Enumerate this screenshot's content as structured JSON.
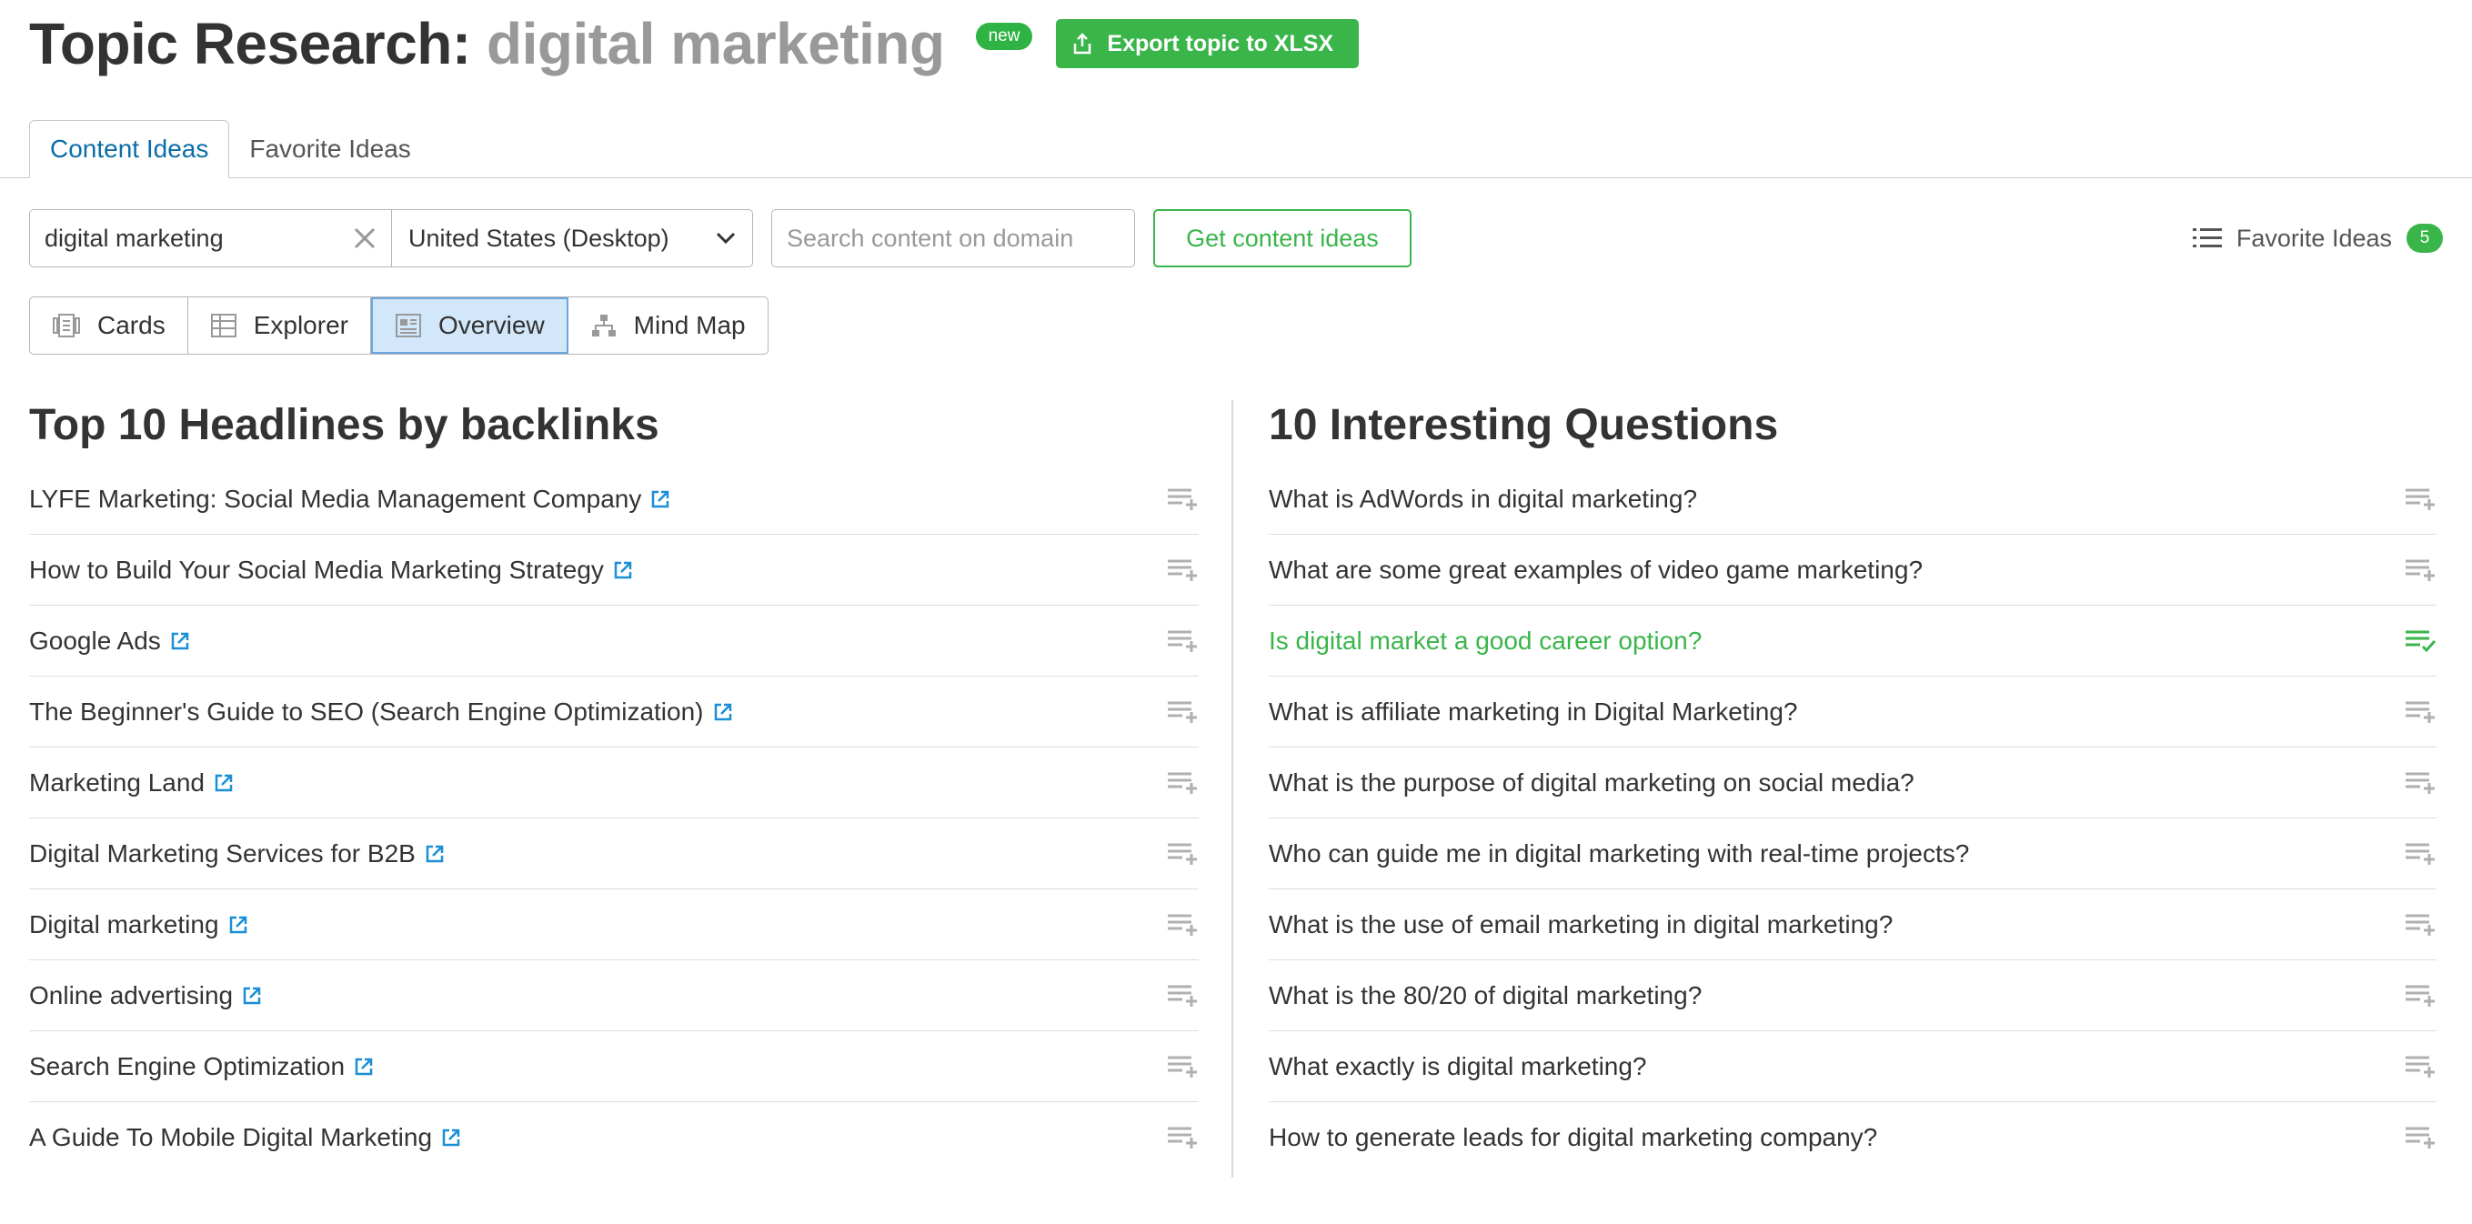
{
  "header": {
    "title_prefix": "Topic Research:",
    "title_keyword": "digital marketing",
    "badge": "new",
    "export_label": "Export topic to XLSX"
  },
  "tabs": [
    {
      "label": "Content Ideas",
      "active": true
    },
    {
      "label": "Favorite Ideas",
      "active": false
    }
  ],
  "search": {
    "keyword_value": "digital marketing",
    "region_value": "United States (Desktop)",
    "domain_placeholder": "Search content on domain",
    "submit_label": "Get content ideas"
  },
  "favorites": {
    "label": "Favorite Ideas",
    "count": "5"
  },
  "views": [
    {
      "label": "Cards",
      "icon": "cards-icon",
      "active": false
    },
    {
      "label": "Explorer",
      "icon": "table-icon",
      "active": false
    },
    {
      "label": "Overview",
      "icon": "overview-icon",
      "active": true
    },
    {
      "label": "Mind Map",
      "icon": "mind-map-icon",
      "active": false
    }
  ],
  "headlines": {
    "title": "Top 10 Headlines by backlinks",
    "items": [
      "LYFE Marketing: Social Media Management Company",
      "How to Build Your Social Media Marketing Strategy",
      "Google Ads",
      "The Beginner's Guide to SEO (Search Engine Optimization)",
      "Marketing Land",
      "Digital Marketing Services for B2B",
      "Digital marketing",
      "Online advertising",
      "Search Engine Optimization",
      "A Guide To Mobile Digital Marketing"
    ]
  },
  "questions": {
    "title": "10 Interesting Questions",
    "items": [
      "What is AdWords in digital marketing?",
      "What are some great examples of video game marketing?",
      "Is digital market a good career option?",
      "What is affiliate marketing in Digital Marketing?",
      "What is the purpose of digital marketing on social media?",
      "Who can guide me in digital marketing with real-time projects?",
      "What is the use of email marketing in digital marketing?",
      "What is the 80/20 of digital marketing?",
      "What exactly is digital marketing?",
      "How to generate leads for digital marketing company?"
    ],
    "favorited_index": 2
  },
  "colors": {
    "accent_green": "#3ab54a",
    "link_blue": "#1a8fd6",
    "active_tab_blue": "#0b6ea8"
  }
}
